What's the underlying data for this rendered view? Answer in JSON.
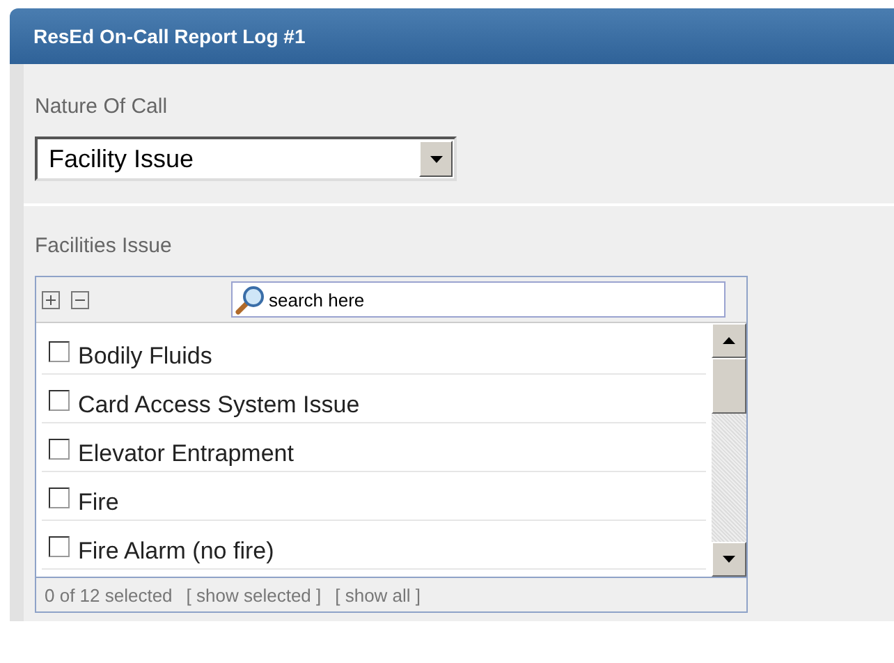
{
  "header": {
    "title": "ResEd On-Call Report Log #1"
  },
  "nature_of_call": {
    "label": "Nature Of Call",
    "value": "Facility Issue"
  },
  "facilities": {
    "label": "Facilities Issue",
    "search": {
      "placeholder": "search here"
    },
    "items": [
      {
        "label": "Bodily Fluids",
        "checked": false
      },
      {
        "label": "Card Access System Issue",
        "checked": false
      },
      {
        "label": "Elevator Entrapment",
        "checked": false
      },
      {
        "label": "Fire",
        "checked": false
      },
      {
        "label": "Fire Alarm (no fire)",
        "checked": false
      }
    ],
    "footer": {
      "count": "0 of 12 selected",
      "show_selected": "[ show selected ]",
      "show_all": "[ show all ]"
    }
  }
}
